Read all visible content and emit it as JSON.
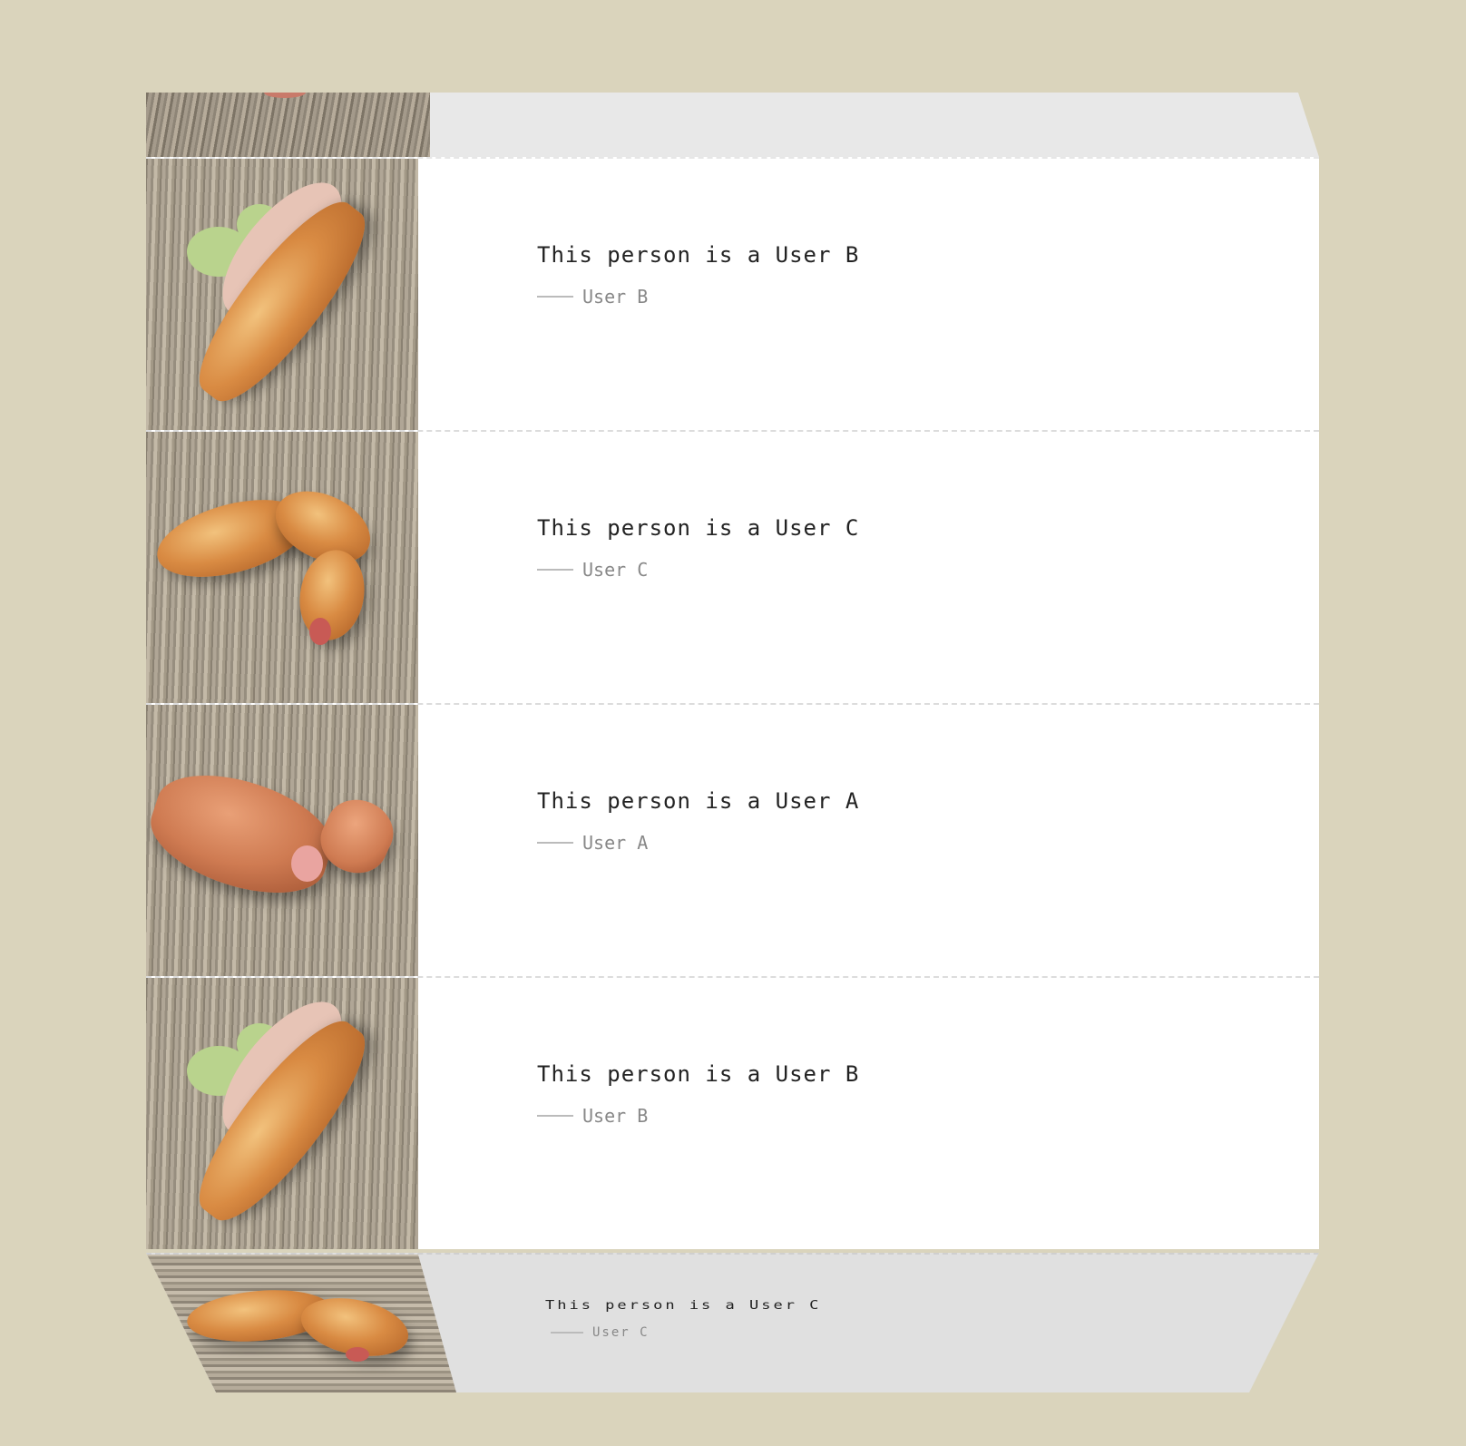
{
  "testimonials": [
    {
      "quote": "This person is a User B",
      "author": "User B",
      "image": "sandwich-baguette"
    },
    {
      "quote": "This person is a User C",
      "author": "User C",
      "image": "curved-sausage-roll"
    },
    {
      "quote": "This person is a User A",
      "author": "User A",
      "image": "pink-sausage-bread"
    },
    {
      "quote": "This person is a User B",
      "author": "User B",
      "image": "sandwich-baguette"
    }
  ],
  "bottom_fold": {
    "quote": "This person is a User C",
    "author": "User C",
    "image": "curved-sausage-roll"
  },
  "colors": {
    "background": "#dad4bc",
    "card": "#ffffff",
    "fold": "#e8e8e8"
  }
}
